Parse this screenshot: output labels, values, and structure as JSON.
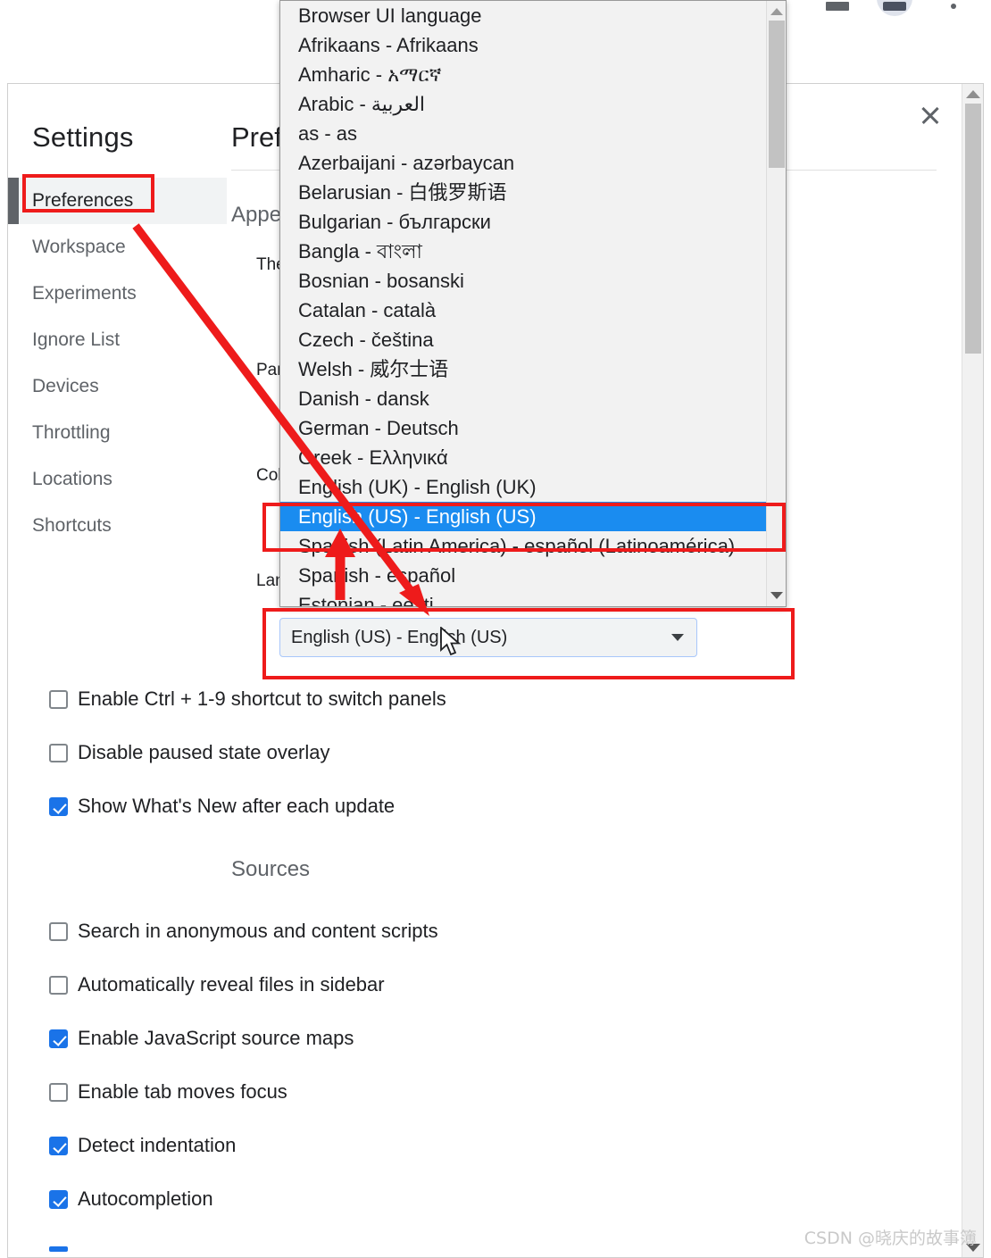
{
  "browser": {
    "icons": [
      "bookmark-manager-icon",
      "star-icon",
      "extensions-icon",
      "profile-avatar-icon",
      "more-menu-icon"
    ]
  },
  "settings": {
    "title": "Settings",
    "close_label": "×",
    "nav": [
      {
        "label": "Preferences",
        "selected": true
      },
      {
        "label": "Workspace",
        "selected": false
      },
      {
        "label": "Experiments",
        "selected": false
      },
      {
        "label": "Ignore List",
        "selected": false
      },
      {
        "label": "Devices",
        "selected": false
      },
      {
        "label": "Throttling",
        "selected": false
      },
      {
        "label": "Locations",
        "selected": false
      },
      {
        "label": "Shortcuts",
        "selected": false
      }
    ],
    "main": {
      "heading": "Preferences",
      "sections": [
        {
          "title": "Appearance"
        },
        {
          "title": "Sources"
        }
      ],
      "appearance_fields": [
        {
          "label": "Theme"
        },
        {
          "label": "Panel layout"
        },
        {
          "label": "Color format"
        },
        {
          "label": "Language"
        }
      ],
      "language_select": {
        "value": "English (US) - English (US)",
        "caret": "chevron-down-icon"
      },
      "appearance_checkboxes": [
        {
          "label": "Enable Ctrl + 1-9 shortcut to switch panels",
          "checked": false
        },
        {
          "label": "Disable paused state overlay",
          "checked": false
        },
        {
          "label": "Show What's New after each update",
          "checked": true
        }
      ],
      "sources_checkboxes": [
        {
          "label": "Search in anonymous and content scripts",
          "checked": false
        },
        {
          "label": "Automatically reveal files in sidebar",
          "checked": false
        },
        {
          "label": "Enable JavaScript source maps",
          "checked": true
        },
        {
          "label": "Enable tab moves focus",
          "checked": false
        },
        {
          "label": "Detect indentation",
          "checked": true
        },
        {
          "label": "Autocompletion",
          "checked": true
        }
      ]
    }
  },
  "dropdown": {
    "open": true,
    "selected_value": "English (US) - English (US)",
    "items": [
      {
        "label": "Browser UI language",
        "selected": false
      },
      {
        "label": "Afrikaans - Afrikaans",
        "selected": false
      },
      {
        "label": "Amharic - አማርኛ",
        "selected": false
      },
      {
        "label": "Arabic - العربية",
        "selected": false
      },
      {
        "label": "as - as",
        "selected": false
      },
      {
        "label": "Azerbaijani - azərbaycan",
        "selected": false
      },
      {
        "label": "Belarusian - 白俄罗斯语",
        "selected": false
      },
      {
        "label": "Bulgarian - български",
        "selected": false
      },
      {
        "label": "Bangla - বাংলা",
        "selected": false
      },
      {
        "label": "Bosnian - bosanski",
        "selected": false
      },
      {
        "label": "Catalan - català",
        "selected": false
      },
      {
        "label": "Czech - čeština",
        "selected": false
      },
      {
        "label": "Welsh - 威尔士语",
        "selected": false
      },
      {
        "label": "Danish - dansk",
        "selected": false
      },
      {
        "label": "German - Deutsch",
        "selected": false
      },
      {
        "label": "Greek - Ελληνικά",
        "selected": false
      },
      {
        "label": "English (UK) - English (UK)",
        "selected": false
      },
      {
        "label": "English (US) - English (US)",
        "selected": true
      },
      {
        "label": "Spanish (Latin America) - español (Latinoamérica)",
        "selected": false
      },
      {
        "label": "Spanish - español",
        "selected": false
      },
      {
        "label": "Estonian - eesti",
        "selected": false
      }
    ]
  },
  "annotations": {
    "color": "#ee1b1b",
    "boxes": [
      "preferences-nav-item",
      "selected-dropdown-option",
      "language-select-control"
    ],
    "arrows": [
      "arrow-preferences-to-select",
      "arrow-pointing-to-selected-option"
    ]
  },
  "watermark": {
    "text": "CSDN @晓庆的故事簿"
  },
  "colors": {
    "accent": "#1a73e8",
    "highlight": "#1a8cf0",
    "annotation": "#ee1b1b",
    "sidebar_selected_bg": "#f1f3f4",
    "dropdown_bg": "#f2f2f2"
  }
}
